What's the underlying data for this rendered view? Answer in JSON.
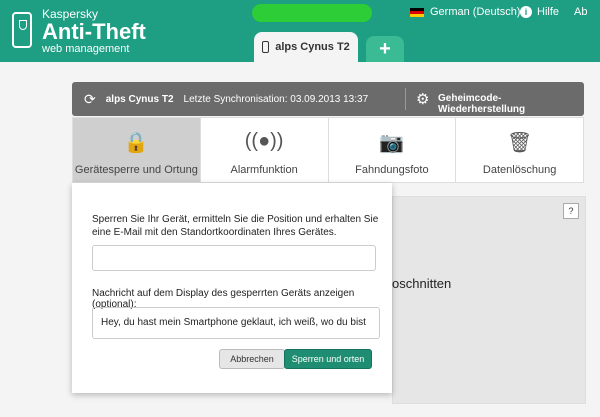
{
  "brand": {
    "kaspersky": "Kaspersky",
    "product": "Anti-Theft",
    "sub": "web management"
  },
  "header": {
    "language": "German (Deutsch)",
    "help": "Hilfe",
    "logout": "Ab"
  },
  "tabs": {
    "device": "alps Cynus T2",
    "add": "+"
  },
  "sync": {
    "device": "alps Cynus T2",
    "last_sync": "Letzte Synchronisation: 03.09.2013 13:37",
    "recovery": "Geheimcode-Wiederherstellung"
  },
  "features": [
    {
      "label": "Gerätesperre und Ortung",
      "icon": "lock-locate-icon"
    },
    {
      "label": "Alarmfunktion",
      "icon": "alarm-icon"
    },
    {
      "label": "Fahndungsfoto",
      "icon": "camera-icon"
    },
    {
      "label": "Datenlöschung",
      "icon": "trash-icon"
    }
  ],
  "dialog": {
    "description": "Sperren Sie Ihr Gerät, ermitteln Sie die Position und erhalten Sie eine E-Mail mit den Standortkoordinaten Ihres Gerätes.",
    "code_placeholder": "",
    "message_label": "Nachricht auf dem Display des gesperrten Geräts anzeigen (optional):",
    "message_value": "Hey, du hast mein Smartphone geklaut, ich weiß, wo du bist",
    "cancel": "Abbrechen",
    "confirm": "Sperren und orten"
  },
  "behind_text": "oschnitten",
  "help_q": "?"
}
